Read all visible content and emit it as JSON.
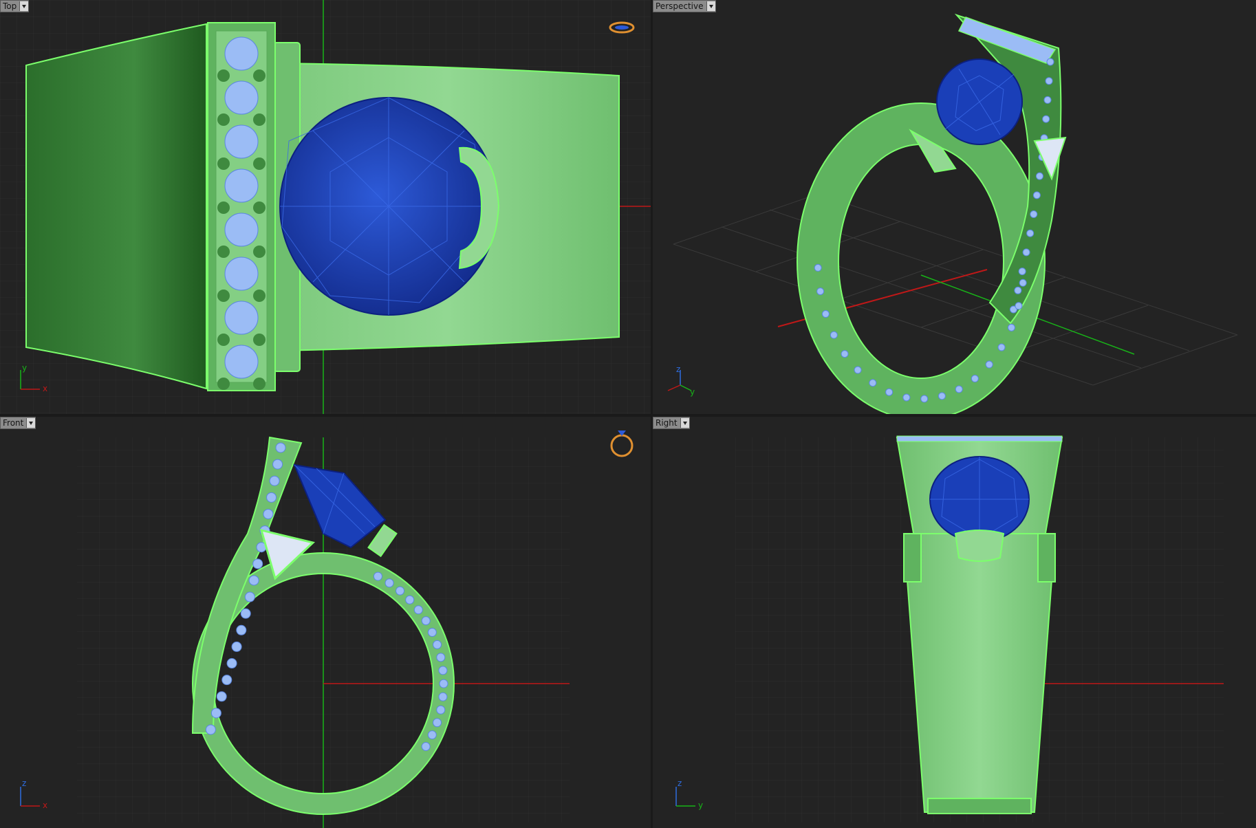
{
  "viewports": {
    "top": {
      "label": "Top",
      "axes": [
        "y",
        "x"
      ]
    },
    "perspective": {
      "label": "Perspective",
      "axes": [
        "z",
        "y"
      ]
    },
    "front": {
      "label": "Front",
      "axes": [
        "z",
        "x"
      ]
    },
    "right": {
      "label": "Right",
      "axes": [
        "z",
        "y"
      ]
    }
  },
  "icons": {
    "viewport_menu": "chevron-down-icon",
    "view_gizmo": "ring-icon",
    "axis_widget": "axis-icon"
  },
  "colors": {
    "background": "#232323",
    "grid_line": "#2e2e2e",
    "grid_major": "#3a3a3a",
    "axis_x": "#c01818",
    "axis_y": "#18b418",
    "axis_z": "#2e6de0",
    "metal_light": "#92d892",
    "metal_mid": "#5fb35f",
    "metal_dark": "#2b6e2b",
    "edge_highlight": "#7cff6c",
    "gem_blue": "#1a3fb8",
    "gem_wire": "#2d5ad8",
    "pave_stone": "#9bbcf5",
    "gizmo_orange": "#e09030"
  }
}
